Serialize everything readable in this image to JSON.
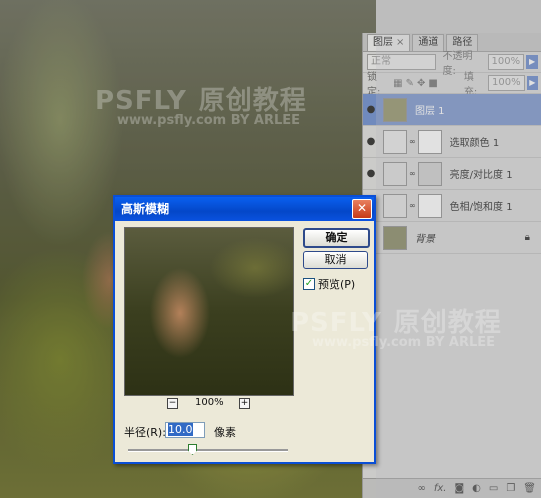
{
  "watermarks": [
    {
      "brand": "PSFLY",
      "cn": "原创教程",
      "url": "www.psfly.com BY ARLEE"
    },
    {
      "brand": "PSFLY",
      "cn": "原创教程",
      "url": "www.psfly.com BY ARLEE"
    }
  ],
  "layers_panel": {
    "tabs": [
      {
        "label": "图层",
        "closable": true,
        "active": true
      },
      {
        "label": "通道",
        "closable": false,
        "active": false
      },
      {
        "label": "路径",
        "closable": false,
        "active": false
      }
    ],
    "blend_mode": "正常",
    "opacity_label": "不透明度:",
    "opacity_value": "100%",
    "lock_label": "锁定:",
    "fill_label": "填充:",
    "fill_value": "100%",
    "layers": [
      {
        "name": "图层 1",
        "selected": true,
        "has_mask": false
      },
      {
        "name": "选取颜色 1",
        "selected": false,
        "has_mask": true
      },
      {
        "name": "亮度/对比度 1",
        "selected": false,
        "has_mask": true
      },
      {
        "name": "色相/饱和度 1",
        "selected": false,
        "has_mask": true
      },
      {
        "name": "背景",
        "selected": false,
        "has_mask": false,
        "italic": true,
        "locked": true
      }
    ],
    "bottom_icons": [
      "link-icon",
      "fx-icon",
      "mask-icon",
      "adjustment-icon",
      "folder-icon",
      "new-layer-icon",
      "trash-icon"
    ]
  },
  "dialog": {
    "title": "高斯模糊",
    "ok_label": "确定",
    "cancel_label": "取消",
    "preview_label": "预览(P)",
    "preview_checked": true,
    "zoom_value": "100%",
    "zoom_out": "−",
    "zoom_in": "+",
    "radius_label": "半径(R):",
    "radius_value": "10.0",
    "unit_label": "像素"
  }
}
